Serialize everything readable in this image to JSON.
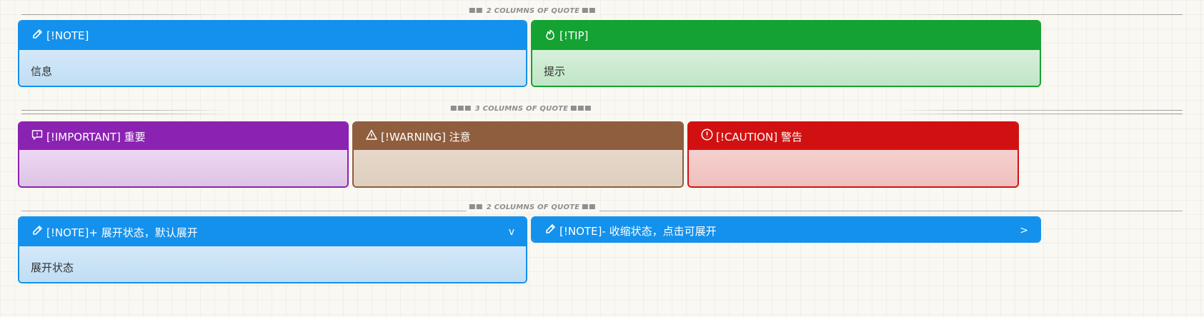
{
  "dividers": [
    {
      "label": "2 COLUMNS OF QUOTE"
    },
    {
      "label": "3 COLUMNS OF QUOTE"
    },
    {
      "label": "2 COLUMNS OF QUOTE"
    }
  ],
  "row1": {
    "note": {
      "title": "[!NOTE]",
      "body": "信息",
      "icon": "pencil-icon"
    },
    "tip": {
      "title": "[!TIP]",
      "body": "提示",
      "icon": "flame-icon"
    }
  },
  "row2": {
    "important": {
      "title": "[!IMPORTANT] 重要",
      "body": "",
      "icon": "speech-bubble-exclamation-icon"
    },
    "warning": {
      "title": "[!WARNING] 注意",
      "body": "",
      "icon": "warning-triangle-icon"
    },
    "caution": {
      "title": "[!CAUTION] 警告",
      "body": "",
      "icon": "circle-exclamation-icon"
    }
  },
  "row3": {
    "expanded": {
      "title": "[!NOTE]+ 展开状态，默认展开",
      "body": "展开状态",
      "fold": "v",
      "icon": "pencil-icon"
    },
    "collapsed": {
      "title": "[!NOTE]- 收缩状态，点击可展开",
      "fold": ">",
      "icon": "pencil-icon"
    }
  },
  "colors": {
    "note": "#1491ec",
    "tip": "#14a232",
    "important": "#8a22b2",
    "warning": "#8f5e3e",
    "caution": "#d11111",
    "background": "#faf8f2"
  }
}
